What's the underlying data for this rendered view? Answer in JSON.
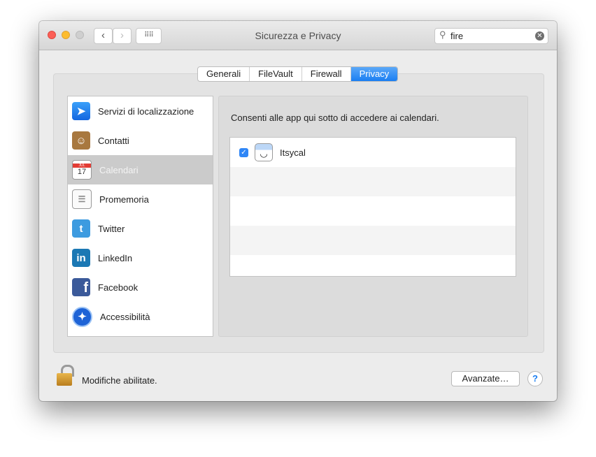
{
  "window": {
    "title": "Sicurezza e Privacy",
    "search_value": "fire"
  },
  "tabs": [
    {
      "label": "Generali"
    },
    {
      "label": "FileVault"
    },
    {
      "label": "Firewall"
    },
    {
      "label": "Privacy"
    }
  ],
  "sidebar": {
    "items": [
      {
        "label": "Servizi di localizzazione",
        "icon": "location-arrow-icon"
      },
      {
        "label": "Contatti",
        "icon": "contacts-book-icon"
      },
      {
        "label": "Calendari",
        "icon": "calendar-icon",
        "selected": true,
        "cal_month": "JUL",
        "cal_day": "17"
      },
      {
        "label": "Promemoria",
        "icon": "reminders-icon"
      },
      {
        "label": "Twitter",
        "icon": "twitter-icon"
      },
      {
        "label": "LinkedIn",
        "icon": "linkedin-icon"
      },
      {
        "label": "Facebook",
        "icon": "facebook-icon"
      },
      {
        "label": "Accessibilità",
        "icon": "accessibility-icon"
      }
    ]
  },
  "main": {
    "description": "Consenti alle app qui sotto di accedere ai calendari.",
    "apps": [
      {
        "name": "Itsycal",
        "checked": true
      }
    ]
  },
  "footer": {
    "lock_label": "Modifiche abilitate.",
    "advanced_button": "Avanzate…",
    "help": "?"
  }
}
